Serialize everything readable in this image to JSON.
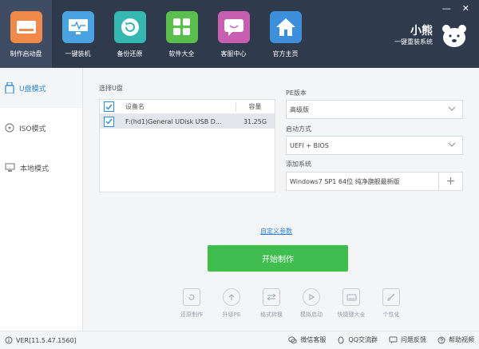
{
  "nav": {
    "items": [
      {
        "label": "制作启动盘",
        "icon": "usb-drive-icon",
        "color": "#f08a4b"
      },
      {
        "label": "一键装机",
        "icon": "monitor-icon",
        "color": "#4aa3e0"
      },
      {
        "label": "备份还原",
        "icon": "restore-icon",
        "color": "#37b7b2"
      },
      {
        "label": "软件大全",
        "icon": "apps-grid-icon",
        "color": "#5bbf4e"
      },
      {
        "label": "客服中心",
        "icon": "chat-icon",
        "color": "#c75fb0"
      },
      {
        "label": "官方主页",
        "icon": "home-icon",
        "color": "#3d8fdc"
      }
    ]
  },
  "brand": {
    "title": "小熊",
    "subtitle": "一键重装系统"
  },
  "sidebar": {
    "items": [
      {
        "label": "U盘模式",
        "icon": "usb-icon"
      },
      {
        "label": "ISO模式",
        "icon": "disc-icon"
      },
      {
        "label": "本地模式",
        "icon": "computer-icon"
      }
    ]
  },
  "usb": {
    "section_label": "选择U盘",
    "headers": {
      "name": "设备名",
      "capacity": "容量"
    },
    "rows": [
      {
        "name": "F:(hd1)General UDisk USB D...",
        "capacity": "31.25G",
        "checked": true
      }
    ]
  },
  "pe": {
    "version_label": "PE版本",
    "version_value": "高级版",
    "boot_label": "启动方式",
    "boot_value": "UEFI + BIOS",
    "system_label": "添加系统",
    "system_value": "Windows7 SP1 64位 纯净旗舰最新版",
    "add_symbol": "+"
  },
  "actions": {
    "custom_params": "自定义参数",
    "start": "开始制作"
  },
  "tools": [
    {
      "label": "还原制作",
      "icon": "restore-tool-icon"
    },
    {
      "label": "升级PE",
      "icon": "upgrade-icon"
    },
    {
      "label": "格式转换",
      "icon": "convert-icon"
    },
    {
      "label": "模拟启动",
      "icon": "play-icon"
    },
    {
      "label": "快捷键大全",
      "icon": "keyboard-icon"
    },
    {
      "label": "个性化",
      "icon": "brush-icon"
    }
  ],
  "status": {
    "version": "VER[11.5.47.1560]",
    "links": [
      {
        "label": "微信客服",
        "icon": "wechat-icon"
      },
      {
        "label": "QQ交流群",
        "icon": "qq-icon"
      },
      {
        "label": "问题反馈",
        "icon": "feedback-icon"
      },
      {
        "label": "帮助视频",
        "icon": "help-icon"
      }
    ]
  },
  "colors": {
    "topbar": "#2f3a4d",
    "accent": "#2a8bd8",
    "start_button": "#3fbe4f"
  }
}
